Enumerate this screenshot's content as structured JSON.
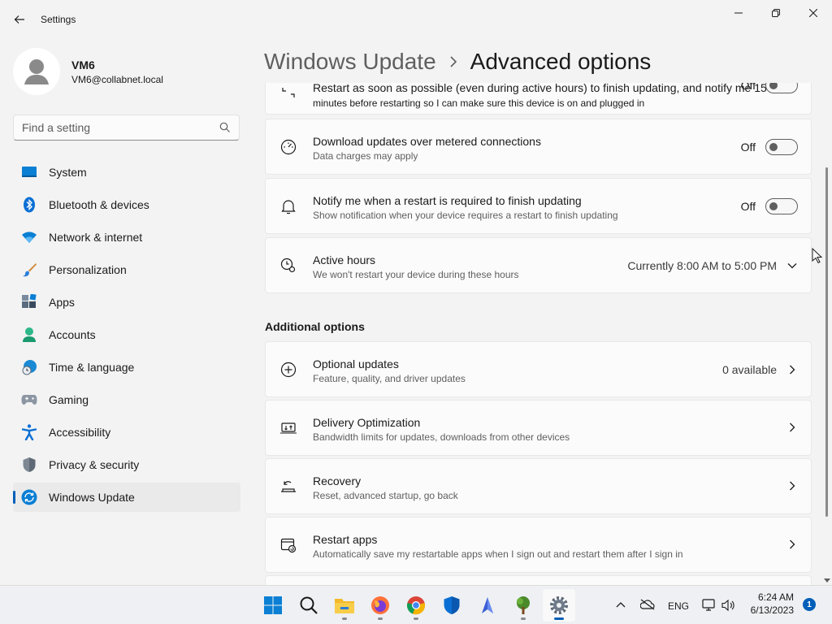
{
  "window": {
    "title": "Settings"
  },
  "profile": {
    "name": "VM6",
    "email": "VM6@collabnet.local"
  },
  "search": {
    "placeholder": "Find a setting"
  },
  "sidebar": {
    "items": [
      {
        "label": "System",
        "icon": "system-icon"
      },
      {
        "label": "Bluetooth & devices",
        "icon": "bluetooth-icon"
      },
      {
        "label": "Network & internet",
        "icon": "wifi-icon"
      },
      {
        "label": "Personalization",
        "icon": "brush-icon"
      },
      {
        "label": "Apps",
        "icon": "apps-icon"
      },
      {
        "label": "Accounts",
        "icon": "accounts-icon"
      },
      {
        "label": "Time & language",
        "icon": "globe-clock-icon"
      },
      {
        "label": "Gaming",
        "icon": "gamepad-icon"
      },
      {
        "label": "Accessibility",
        "icon": "accessibility-icon"
      },
      {
        "label": "Privacy & security",
        "icon": "shield-icon"
      },
      {
        "label": "Windows Update",
        "icon": "windows-update-icon",
        "active": true
      }
    ]
  },
  "breadcrumb": {
    "parent": "Windows Update",
    "current": "Advanced options"
  },
  "cards": {
    "restart_asap": {
      "title": "Restart as soon as possible (even during active hours) to finish updating, and notify me 15",
      "subtitle": "minutes before restarting so I can make sure this device is on and plugged in",
      "state": "Off"
    },
    "metered": {
      "title": "Download updates over metered connections",
      "subtitle": "Data charges may apply",
      "state": "Off"
    },
    "notify_restart": {
      "title": "Notify me when a restart is required to finish updating",
      "subtitle": "Show notification when your device requires a restart to finish updating",
      "state": "Off"
    },
    "active_hours": {
      "title": "Active hours",
      "subtitle": "We won't restart your device during these hours",
      "value": "Currently 8:00 AM to 5:00 PM"
    }
  },
  "additional": {
    "heading": "Additional options",
    "optional_updates": {
      "title": "Optional updates",
      "subtitle": "Feature, quality, and driver updates",
      "value": "0 available"
    },
    "delivery_optimization": {
      "title": "Delivery Optimization",
      "subtitle": "Bandwidth limits for updates, downloads from other devices"
    },
    "recovery": {
      "title": "Recovery",
      "subtitle": "Reset, advanced startup, go back"
    },
    "restart_apps": {
      "title": "Restart apps",
      "subtitle": "Automatically save my restartable apps when I sign out and restart them after I sign in"
    }
  },
  "taskbar": {
    "apps": [
      "start-icon",
      "search-icon",
      "file-explorer-icon",
      "firefox-icon",
      "chrome-icon",
      "defender-icon",
      "app-icon",
      "tree-app-icon",
      "settings-icon"
    ],
    "language": "ENG",
    "time": "6:24 AM",
    "date": "6/13/2023",
    "notifications": "1"
  },
  "colors": {
    "accent": "#005fb8",
    "background": "#f3f3f3",
    "card": "#fbfbfb"
  }
}
